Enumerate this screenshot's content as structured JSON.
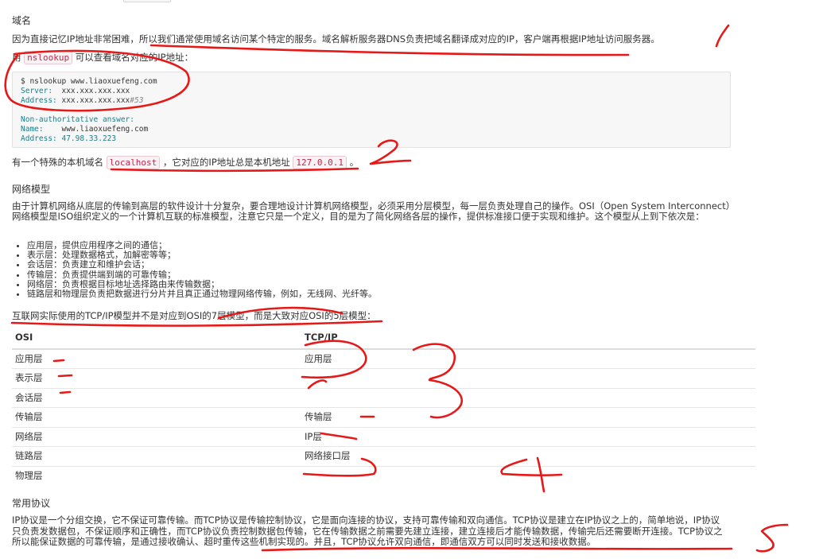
{
  "domain_section": {
    "heading": "域名",
    "intro": "因为直接记忆IP地址非常困难，所以我们通常使用域名访问某个特定的服务。域名解析服务器DNS负责把域名翻译成对应的IP，客户端再根据IP地址访问服务器。",
    "lookup_prefix": "用",
    "lookup_cmd": "nslookup",
    "lookup_suffix": "可以查看域名对应的IP地址：",
    "code": {
      "prompt": "$ nslookup www.liaoxuefeng.com",
      "server_label": "Server:",
      "server_value": "  xxx.xxx.xxx.xxx",
      "address_label": "Address:",
      "address_value": " xxx.xxx.xxx.xxx",
      "address_port": "#53",
      "non_auth": "Non-authoritative answer:",
      "name_label": "Name:",
      "name_value": "    www.liaoxuefeng.com",
      "address2_label": "Address:",
      "address2_value": " 47.98.33.223"
    },
    "localhost_prefix": "有一个特殊的本机域名",
    "localhost_code": "localhost",
    "localhost_mid": "，它对应的IP地址总是本机地址",
    "localhost_ip": "127.0.0.1",
    "localhost_end": "。"
  },
  "network_section": {
    "heading": "网络模型",
    "intro": "由于计算机网络从底层的传输到高层的软件设计十分复杂，要合理地设计计算机网络模型，必须采用分层模型，每一层负责处理自己的操作。OSI（Open System Interconnect）网络模型是ISO组织定义的一个计算机互联的标准模型，注意它只是一个定义，目的是为了简化网络各层的操作，提供标准接口便于实现和维护。这个模型从上到下依次是：",
    "layers": [
      "应用层，提供应用程序之间的通信；",
      "表示层：处理数据格式，加解密等等；",
      "会话层：负责建立和维护会话；",
      "传输层：负责提供端到端的可靠传输；",
      "网络层：负责根据目标地址选择路由来传输数据；",
      "链路层和物理层负责把数据进行分片并且真正通过物理网络传输，例如，无线网、光纤等。"
    ],
    "tcpip_note": "互联网实际使用的TCP/IP模型并不是对应到OSI的7层模型，而是大致对应OSI的5层模型：",
    "table": {
      "headers": [
        "OSI",
        "TCP/IP"
      ],
      "rows": [
        [
          "应用层",
          "应用层"
        ],
        [
          "表示层",
          ""
        ],
        [
          "会话层",
          ""
        ],
        [
          "传输层",
          "传输层"
        ],
        [
          "网络层",
          "IP层"
        ],
        [
          "链路层",
          "网络接口层"
        ],
        [
          "物理层",
          ""
        ]
      ]
    }
  },
  "protocol_section": {
    "heading": "常用协议",
    "body": "IP协议是一个分组交换，它不保证可靠传输。而TCP协议是传输控制协议，它是面向连接的协议，支持可靠传输和双向通信。TCP协议是建立在IP协议之上的，简单地说，IP协议只负责发数据包，不保证顺序和正确性，而TCP协议负责控制数据包传输，它在传输数据之前需要先建立连接，建立连接后才能传输数据，传输完后还需要断开连接。TCP协议之所以能保证数据的可靠传输，是通过接收确认、超时重传这些机制实现的。并且，TCP协议允许双向通信，即通信双方可以同时发送和接收数据。"
  },
  "annotation_color": "#e61919"
}
